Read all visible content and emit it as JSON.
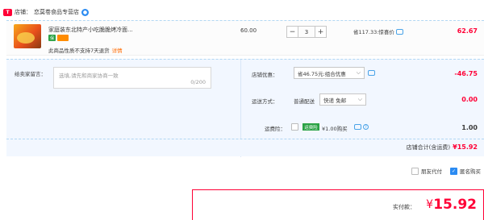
{
  "store": {
    "prefix": "店铺：",
    "name": "恋莫卷食品专营店"
  },
  "item": {
    "title": "家庭装东北特产小吃脆脆烤冷面...",
    "return_note": "此商品性质不支持7天退货",
    "detail_link": "详情",
    "unit_price": "60.00",
    "quantity": "3",
    "save_text": "省117.33:惊喜价",
    "line_total": "62.67"
  },
  "options": {
    "msg_label": "给卖家留言：",
    "msg_placeholder": "选填,请先和商家协商一致",
    "msg_counter": "0/200",
    "discount_label": "店铺优惠：",
    "discount_value": "省46.75元:组合优惠",
    "discount_amount": "-46.75",
    "shipping_label": "运送方式：",
    "shipping_type": "普通配送",
    "shipping_value": "快递 免邮",
    "shipping_amount": "0.00",
    "insurance_label": "运费险：",
    "insurance_tag": "运费险",
    "insurance_text": "¥1.00购买",
    "insurance_amount": "1.00"
  },
  "subtotal": {
    "label": "店铺合计(含运费)",
    "value": "¥15.92"
  },
  "toggles": {
    "friend_pay": "朋友代付",
    "anonymous": "匿名购买"
  },
  "payment": {
    "label": "实付款：",
    "currency": "¥",
    "value": "15.92"
  },
  "colors": {
    "accent": "#ff0036",
    "blue": "#2b8bf2",
    "light_bg": "#f2f7ff"
  }
}
